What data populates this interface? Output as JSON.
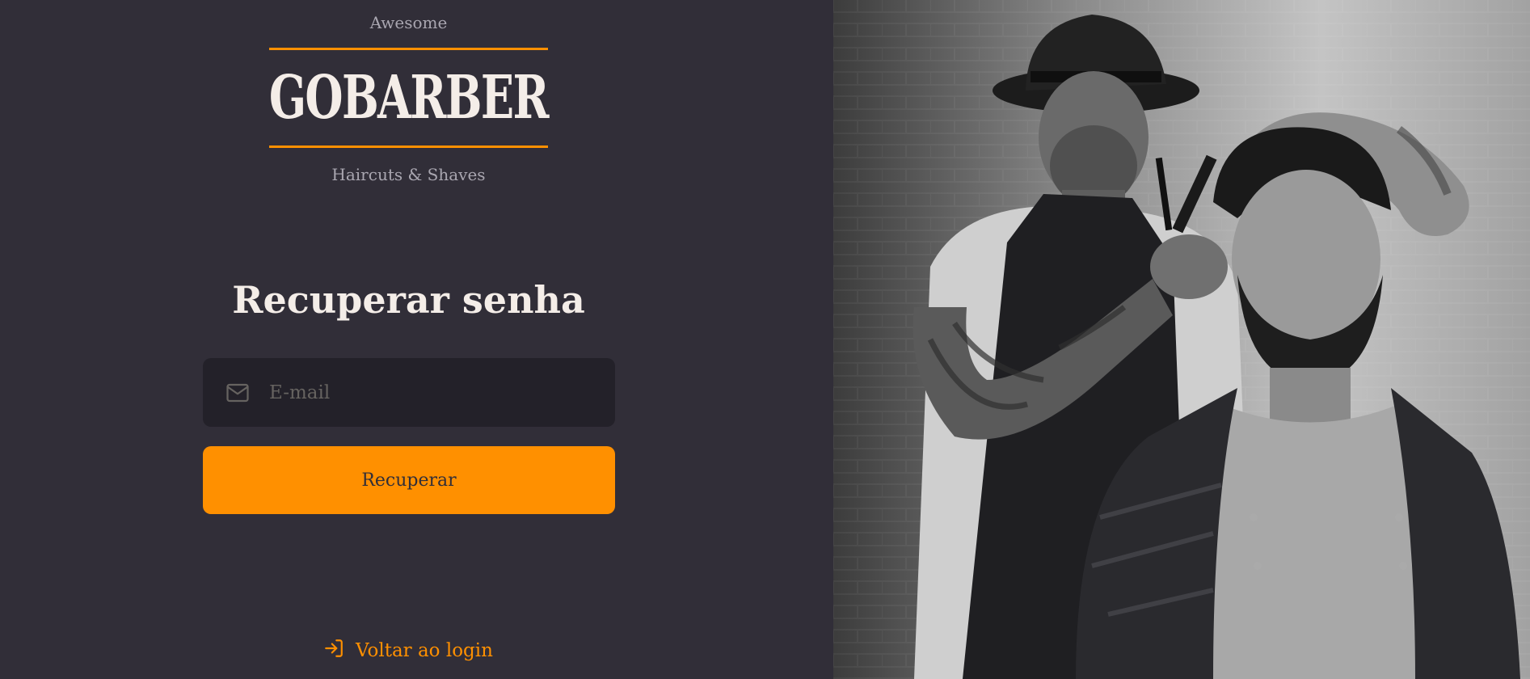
{
  "logo": {
    "top_text": "Awesome",
    "brand": "GOBARBER",
    "bottom_text": "Haircuts & Shaves",
    "accent_color": "#ff9000"
  },
  "form": {
    "title": "Recuperar senha",
    "email": {
      "icon": "mail-icon",
      "placeholder": "E-mail",
      "value": ""
    },
    "submit_label": "Recuperar"
  },
  "back_link": {
    "icon": "log-in-icon",
    "label": "Voltar ao login"
  },
  "hero_image": {
    "description": "barber-photo"
  },
  "colors": {
    "background": "#312e38",
    "input_background": "#232129",
    "primary": "#ff9000",
    "text": "#f4ede8",
    "muted": "#a9a6b0"
  }
}
